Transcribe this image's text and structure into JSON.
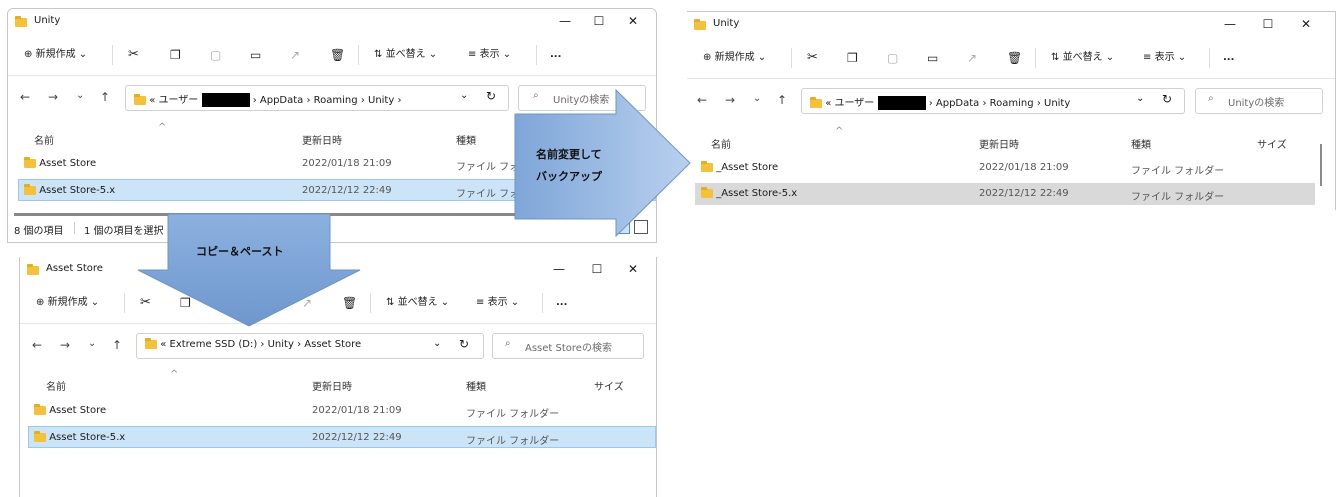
{
  "windows": {
    "top_left": {
      "title": "Unity",
      "toolbar": {
        "new_label": "新規作成",
        "sort_label": "並べ替え",
        "view_label": "表示",
        "more_label": "..."
      },
      "nav": {
        "back": "←",
        "forward": "→",
        "recent": "⌄",
        "up": "↑"
      },
      "address": {
        "prefix": "«",
        "seg1": "ユーザー",
        "seg2": "AppData",
        "seg3": "Roaming",
        "seg4": "Unity",
        "sep": "›"
      },
      "search_placeholder": "Unityの検索",
      "columns": {
        "name": "名前",
        "date": "更新日時",
        "type": "種類"
      },
      "rows": [
        {
          "name": "Asset Store",
          "date": "2022/01/18 21:09",
          "type": "ファイル フォルダー"
        },
        {
          "name": "Asset Store-5.x",
          "date": "2022/12/12 22:49",
          "type": "ファイル フォルダー"
        }
      ],
      "status": {
        "count": "8 個の項目",
        "selected": "1 個の項目を選択"
      }
    },
    "bottom": {
      "title": "Asset Store",
      "toolbar": {
        "new_label": "新規作成",
        "sort_label": "並べ替え",
        "view_label": "表示",
        "more_label": "..."
      },
      "address": {
        "prefix": "«",
        "seg1": "Extreme SSD (D:)",
        "seg2": "Unity",
        "seg3": "Asset Store",
        "sep": "›"
      },
      "search_placeholder": "Asset Storeの検索",
      "columns": {
        "name": "名前",
        "date": "更新日時",
        "type": "種類",
        "size": "サイズ"
      },
      "rows": [
        {
          "name": "Asset Store",
          "date": "2022/01/18 21:09",
          "type": "ファイル フォルダー"
        },
        {
          "name": "Asset Store-5.x",
          "date": "2022/12/12 22:49",
          "type": "ファイル フォルダー"
        }
      ]
    },
    "top_right": {
      "title": "Unity",
      "toolbar": {
        "new_label": "新規作成",
        "sort_label": "並べ替え",
        "view_label": "表示",
        "more_label": "..."
      },
      "address": {
        "prefix": "«",
        "seg1": "ユーザー",
        "seg2": "AppData",
        "seg3": "Roaming",
        "seg4": "Unity",
        "sep": "›"
      },
      "search_placeholder": "Unityの検索",
      "columns": {
        "name": "名前",
        "date": "更新日時",
        "type": "種類",
        "size": "サイズ"
      },
      "rows": [
        {
          "name": "_Asset Store",
          "date": "2022/01/18 21:09",
          "type": "ファイル フォルダー"
        },
        {
          "name": "_Asset Store-5.x",
          "date": "2022/12/12 22:49",
          "type": "ファイル フォルダー"
        }
      ]
    }
  },
  "annotations": {
    "rename_backup_line1": "名前変更して",
    "rename_backup_line2": "バックアップ",
    "copy_paste": "コピー＆ペースト"
  },
  "colors": {
    "arrow_fill": "#8eb4e3",
    "arrow_stroke": "#6f95c4",
    "selection": "#cce4f7",
    "folder": "#f3c13a"
  },
  "window_controls": {
    "minimize": "—",
    "maximize": "☐",
    "close": "✕"
  },
  "icons": {
    "refresh": "↻",
    "dropdown": "⌄",
    "search": "⌕"
  }
}
